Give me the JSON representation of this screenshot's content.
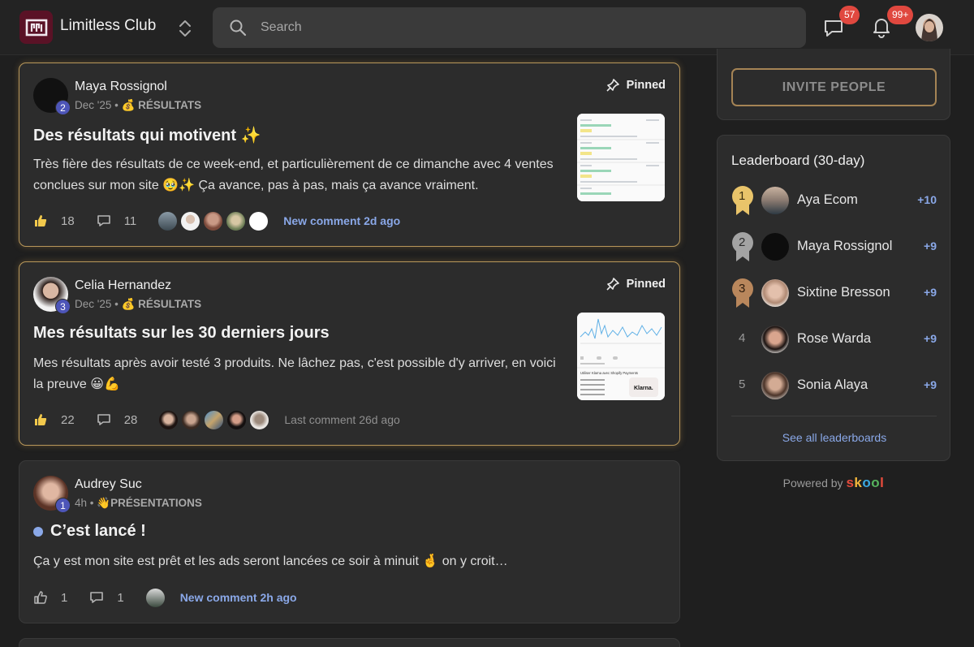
{
  "header": {
    "club_name": "Limitless Club",
    "search_placeholder": "Search",
    "chat_badge": "57",
    "notif_badge": "99+"
  },
  "posts": [
    {
      "author": "Maya Rossignol",
      "level": "2",
      "date": "Dec '25",
      "category_emoji": "💰",
      "category": "RÉSULTATS",
      "pinned_label": "Pinned",
      "title": "Des résultats qui motivent ✨",
      "body": "Très fière des résultats de ce week-end, et particulièrement de ce dimanche avec 4 ventes conclues sur mon site 🥹✨ Ça avance, pas à pas, mais ça avance vraiment.",
      "likes": "18",
      "comments": "11",
      "activity": "New comment 2d ago"
    },
    {
      "author": "Celia Hernandez",
      "level": "3",
      "date": "Dec '25",
      "category_emoji": "💰",
      "category": "RÉSULTATS",
      "pinned_label": "Pinned",
      "title": "Mes résultats sur les 30 derniers jours",
      "body": "Mes résultats après avoir testé 3 produits. Ne lâchez pas, c'est possible d'y arriver, en voici la preuve 😀💪",
      "likes": "22",
      "comments": "28",
      "activity": "Last comment 26d ago"
    },
    {
      "author": "Audrey Suc",
      "level": "1",
      "date": "4h",
      "category_emoji": "👋",
      "category": "PRÉSENTATIONS",
      "title": "C’est lancé !",
      "body": "Ça y est mon site est prêt et les ads seront lancées ce soir à minuit 🤞 on y croit…",
      "likes": "1",
      "comments": "1",
      "activity": "New comment 2h ago"
    }
  ],
  "sidebar": {
    "invite_label": "INVITE PEOPLE",
    "leaderboard_title": "Leaderboard (30-day)",
    "leaderboard": [
      {
        "rank": "1",
        "name": "Aya Ecom",
        "points": "+10"
      },
      {
        "rank": "2",
        "name": "Maya Rossignol",
        "points": "+9"
      },
      {
        "rank": "3",
        "name": "Sixtine Bresson",
        "points": "+9"
      },
      {
        "rank": "4",
        "name": "Rose Warda",
        "points": "+9"
      },
      {
        "rank": "5",
        "name": "Sonia Alaya",
        "points": "+9"
      }
    ],
    "see_all": "See all leaderboards",
    "powered_by": "Powered by",
    "skool": [
      "s",
      "k",
      "o",
      "o",
      "l"
    ]
  },
  "thumbnail_texts": {
    "klarna_caption": "Utiliser Klarna avec Shopify Payments",
    "klarna_logo": "Klarna."
  },
  "colors": {
    "accent_link": "#8aa8e8",
    "pinned_border": "#b8975a",
    "badge": "#e0483f",
    "level_badge": "#4d55b8",
    "skool": [
      "#e64b3c",
      "#f3b63b",
      "#3aa8e0",
      "#56b25d",
      "#e64b3c"
    ]
  }
}
